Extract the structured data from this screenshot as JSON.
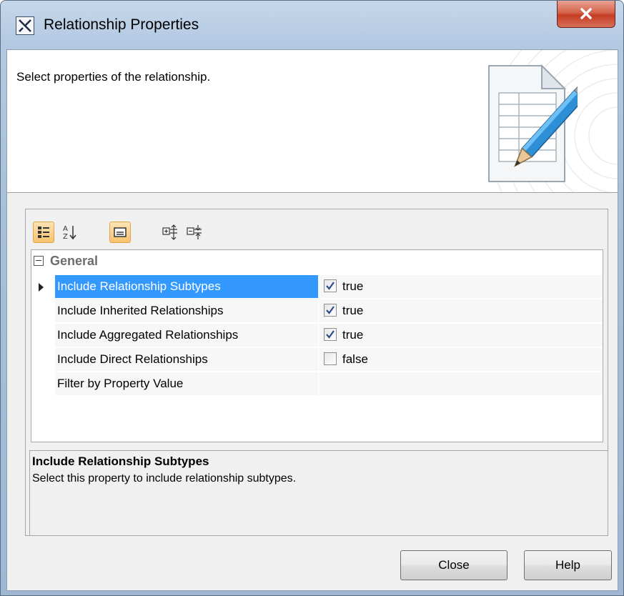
{
  "window": {
    "title": "Relationship Properties"
  },
  "header": {
    "description": "Select properties of the relationship."
  },
  "toolbar": {
    "buttons": [
      {
        "icon": "categorized-view-icon",
        "active": true
      },
      {
        "icon": "sort-alphabetical-icon",
        "active": false
      },
      {
        "icon": "show-description-icon",
        "active": true
      },
      {
        "icon": "expand-all-icon",
        "active": false
      },
      {
        "icon": "collapse-all-icon",
        "active": false
      }
    ]
  },
  "properties": {
    "group_label": "General",
    "rows": [
      {
        "name": "Include Relationship Subtypes",
        "checked": true,
        "value": "true",
        "selected": true
      },
      {
        "name": "Include Inherited Relationships",
        "checked": true,
        "value": "true",
        "selected": false
      },
      {
        "name": "Include Aggregated Relationships",
        "checked": true,
        "value": "true",
        "selected": false
      },
      {
        "name": "Include Direct Relationships",
        "checked": false,
        "value": "false",
        "selected": false
      },
      {
        "name": "Filter by Property Value",
        "checked": null,
        "value": "",
        "selected": false
      }
    ]
  },
  "description": {
    "title": "Include Relationship Subtypes",
    "text": "Select this property to include relationship subtypes."
  },
  "buttons": {
    "close_label": "Close",
    "help_label": "Help"
  },
  "colors": {
    "selection": "#3399ff",
    "title_close": "#c43c23",
    "toolbar_active": "#f7c36e"
  }
}
